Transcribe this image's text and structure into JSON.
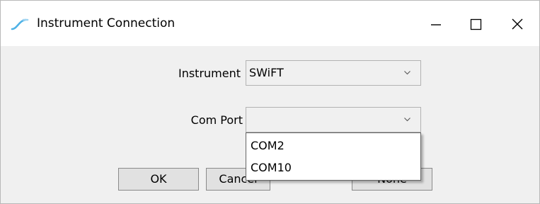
{
  "window": {
    "title": "Instrument Connection",
    "icon": "signal-wave-icon",
    "controls": {
      "minimize": "minimize-icon",
      "maximize": "maximize-icon",
      "close": "close-icon"
    }
  },
  "form": {
    "instrument": {
      "label": "Instrument",
      "value": "SWiFT"
    },
    "com_port": {
      "label": "Com Port",
      "value": ""
    }
  },
  "dropdown": {
    "options": [
      "COM2",
      "COM10"
    ]
  },
  "buttons": {
    "ok": "OK",
    "cancel": "Cancel",
    "none": "None"
  },
  "colors": {
    "icon_accent": "#4fb2e6",
    "dropdown_border": "#646464"
  }
}
